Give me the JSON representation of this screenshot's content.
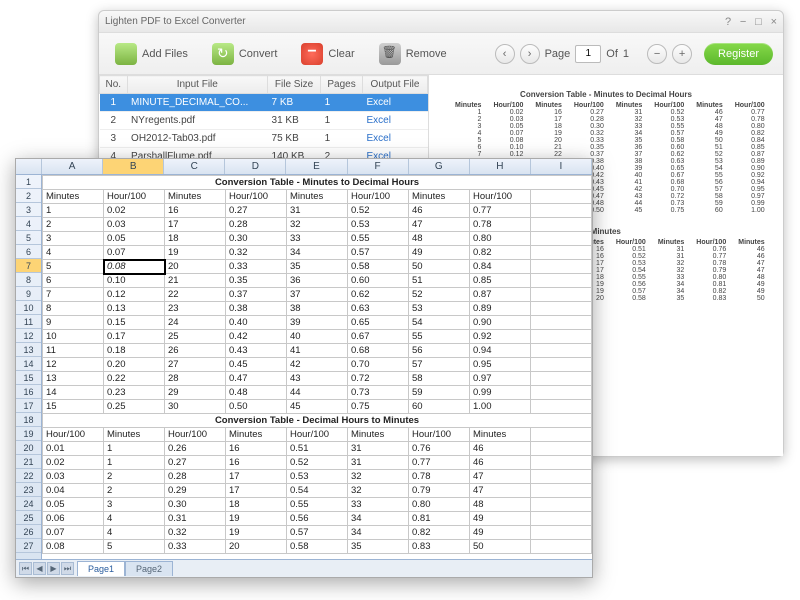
{
  "app": {
    "title": "Lighten PDF to Excel Converter",
    "toolbar": {
      "add_files": "Add Files",
      "convert": "Convert",
      "clear": "Clear",
      "remove": "Remove"
    },
    "pager": {
      "page_label": "Page",
      "page_value": "1",
      "of_label": "Of",
      "total": "1"
    },
    "register": "Register"
  },
  "file_list": {
    "headers": {
      "no": "No.",
      "input": "Input File",
      "size": "File Size",
      "pages": "Pages",
      "output": "Output File"
    },
    "rows": [
      {
        "no": "1",
        "input": "MINUTE_DECIMAL_CO...",
        "size": "7 KB",
        "pages": "1",
        "output": "Excel",
        "selected": true
      },
      {
        "no": "2",
        "input": "NYregents.pdf",
        "size": "31 KB",
        "pages": "1",
        "output": "Excel"
      },
      {
        "no": "3",
        "input": "OH2012-Tab03.pdf",
        "size": "75 KB",
        "pages": "1",
        "output": "Excel"
      },
      {
        "no": "4",
        "input": "ParshallFlume.pdf",
        "size": "140 KB",
        "pages": "2",
        "output": "Excel"
      }
    ]
  },
  "preview": {
    "title1": "Conversion Table - Minutes to Decimal Hours",
    "title2": "Conversion Table - Decimal Hours to Minutes",
    "cols": [
      "Minutes",
      "Hour/100",
      "Minutes",
      "Hour/100",
      "Minutes",
      "Hour/100",
      "Minutes",
      "Hour/100"
    ],
    "cols2": [
      "Hour/100",
      "Minutes",
      "Hour/100",
      "Minutes",
      "Hour/100",
      "Minutes",
      "Hour/100",
      "Minutes"
    ]
  },
  "chart_data": {
    "type": "table",
    "title": "Conversion Table - Minutes to Decimal Hours",
    "columns": [
      "Minutes",
      "Hour/100",
      "Minutes",
      "Hour/100",
      "Minutes",
      "Hour/100",
      "Minutes",
      "Hour/100"
    ],
    "rows": [
      [
        "1",
        "0.02",
        "16",
        "0.27",
        "31",
        "0.52",
        "46",
        "0.77"
      ],
      [
        "2",
        "0.03",
        "17",
        "0.28",
        "32",
        "0.53",
        "47",
        "0.78"
      ],
      [
        "3",
        "0.05",
        "18",
        "0.30",
        "33",
        "0.55",
        "48",
        "0.80"
      ],
      [
        "4",
        "0.07",
        "19",
        "0.32",
        "34",
        "0.57",
        "49",
        "0.82"
      ],
      [
        "5",
        "0.08",
        "20",
        "0.33",
        "35",
        "0.58",
        "50",
        "0.84"
      ],
      [
        "6",
        "0.10",
        "21",
        "0.35",
        "36",
        "0.60",
        "51",
        "0.85"
      ],
      [
        "7",
        "0.12",
        "22",
        "0.37",
        "37",
        "0.62",
        "52",
        "0.87"
      ],
      [
        "8",
        "0.13",
        "23",
        "0.38",
        "38",
        "0.63",
        "53",
        "0.89"
      ],
      [
        "9",
        "0.15",
        "24",
        "0.40",
        "39",
        "0.65",
        "54",
        "0.90"
      ],
      [
        "10",
        "0.17",
        "25",
        "0.42",
        "40",
        "0.67",
        "55",
        "0.92"
      ],
      [
        "11",
        "0.18",
        "26",
        "0.43",
        "41",
        "0.68",
        "56",
        "0.94"
      ],
      [
        "12",
        "0.20",
        "27",
        "0.45",
        "42",
        "0.70",
        "57",
        "0.95"
      ],
      [
        "13",
        "0.22",
        "28",
        "0.47",
        "43",
        "0.72",
        "58",
        "0.97"
      ],
      [
        "14",
        "0.23",
        "29",
        "0.48",
        "44",
        "0.73",
        "59",
        "0.99"
      ],
      [
        "15",
        "0.25",
        "30",
        "0.50",
        "45",
        "0.75",
        "60",
        "1.00"
      ]
    ],
    "title2": "Conversion Table - Decimal Hours to Minutes",
    "columns2": [
      "Hour/100",
      "Minutes",
      "Hour/100",
      "Minutes",
      "Hour/100",
      "Minutes",
      "Hour/100",
      "Minutes"
    ],
    "rows2": [
      [
        "0.01",
        "1",
        "0.26",
        "16",
        "0.51",
        "31",
        "0.76",
        "46"
      ],
      [
        "0.02",
        "1",
        "0.27",
        "16",
        "0.52",
        "31",
        "0.77",
        "46"
      ],
      [
        "0.03",
        "2",
        "0.28",
        "17",
        "0.53",
        "32",
        "0.78",
        "47"
      ],
      [
        "0.04",
        "2",
        "0.29",
        "17",
        "0.54",
        "32",
        "0.79",
        "47"
      ],
      [
        "0.05",
        "3",
        "0.30",
        "18",
        "0.55",
        "33",
        "0.80",
        "48"
      ],
      [
        "0.06",
        "4",
        "0.31",
        "19",
        "0.56",
        "34",
        "0.81",
        "49"
      ],
      [
        "0.07",
        "4",
        "0.32",
        "19",
        "0.57",
        "34",
        "0.82",
        "49"
      ],
      [
        "0.08",
        "5",
        "0.33",
        "20",
        "0.58",
        "35",
        "0.83",
        "50"
      ]
    ]
  },
  "excel": {
    "columns": [
      "A",
      "B",
      "C",
      "D",
      "E",
      "F",
      "G",
      "H",
      "I"
    ],
    "active_cell": "B7",
    "sheets": [
      "Page1",
      "Page2"
    ],
    "title1": "Conversion Table - Minutes to Decimal Hours",
    "title2": "Conversion Table - Decimal Hours to Minutes",
    "headers": [
      "Minutes",
      "Hour/100",
      "Minutes",
      "Hour/100",
      "Minutes",
      "Hour/100",
      "Minutes",
      "Hour/100"
    ],
    "headers2": [
      "Hour/100",
      "Minutes",
      "Hour/100",
      "Minutes",
      "Hour/100",
      "Minutes",
      "Hour/100",
      "Minutes"
    ]
  }
}
